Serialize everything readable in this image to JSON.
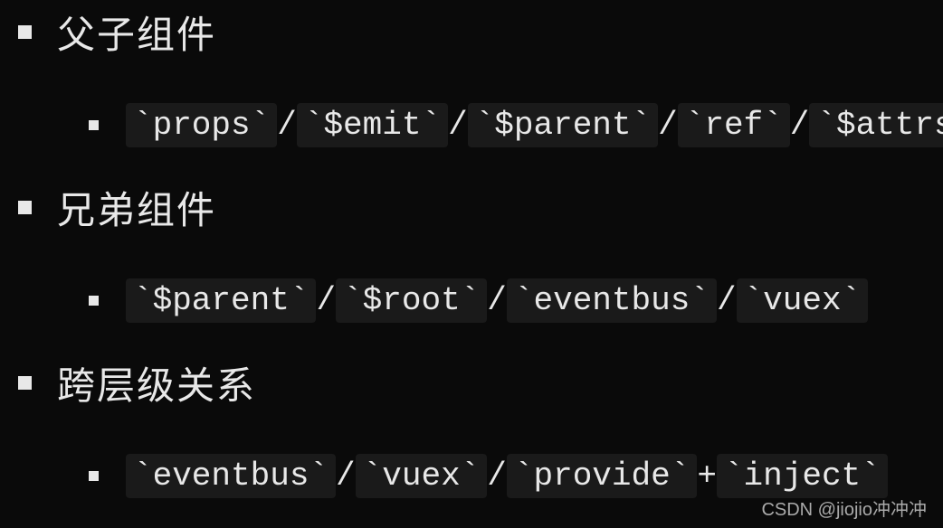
{
  "sections": [
    {
      "heading": "父子组件",
      "code": "`props`/`$emit`/`$parent`/`ref`/`$attrs`"
    },
    {
      "heading": "兄弟组件",
      "code": "`$parent`/`$root`/`eventbus`/`vuex`"
    },
    {
      "heading": "跨层级关系",
      "code": "`eventbus`/`vuex`/`provide`+`inject`"
    }
  ],
  "watermark": "CSDN @jiojio冲冲冲"
}
